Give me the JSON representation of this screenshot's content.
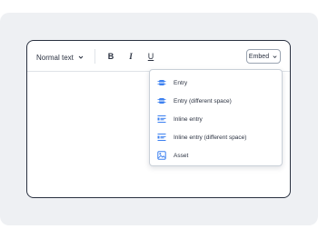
{
  "toolbar": {
    "format_label": "Normal text",
    "bold_label": "B",
    "italic_label": "I",
    "underline_label": "U",
    "embed_label": "Embed"
  },
  "embed_menu": {
    "items": [
      {
        "label": "Entry",
        "icon": "entry-block-icon"
      },
      {
        "label": "Entry (different space)",
        "icon": "entry-block-icon"
      },
      {
        "label": "Inline entry",
        "icon": "inline-entry-icon"
      },
      {
        "label": "Inline entry (different space)",
        "icon": "inline-entry-icon"
      },
      {
        "label": "Asset",
        "icon": "asset-image-icon"
      }
    ]
  },
  "colors": {
    "accent": "#3c80f0",
    "text": "#2a3140",
    "border": "#2a3140",
    "backdrop": "#eef0f3"
  }
}
